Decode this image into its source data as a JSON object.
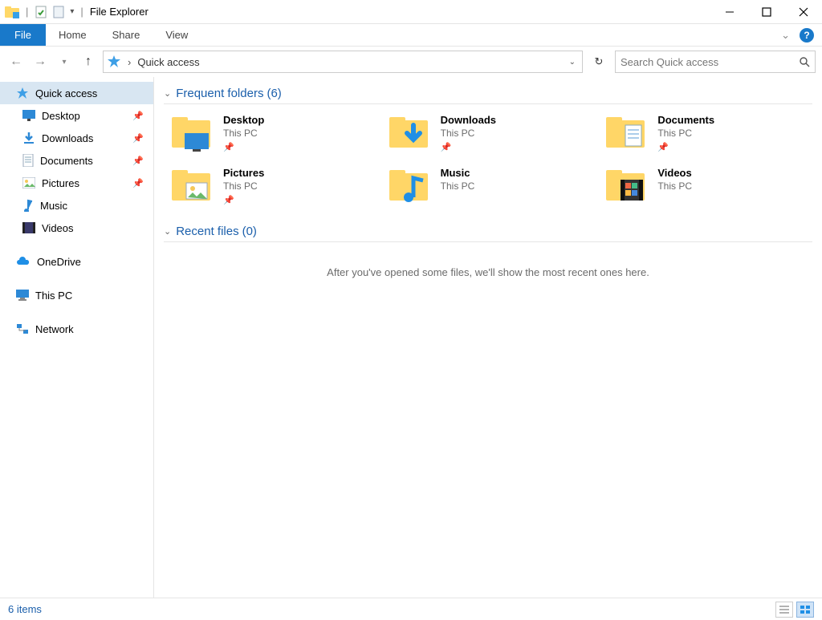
{
  "titlebar": {
    "title": "File Explorer"
  },
  "ribbon": {
    "file": "File",
    "home": "Home",
    "share": "Share",
    "view": "View"
  },
  "address": {
    "location": "Quick access"
  },
  "search": {
    "placeholder": "Search Quick access"
  },
  "sidebar": {
    "quick_access": "Quick access",
    "items": [
      {
        "label": "Desktop"
      },
      {
        "label": "Downloads"
      },
      {
        "label": "Documents"
      },
      {
        "label": "Pictures"
      },
      {
        "label": "Music"
      },
      {
        "label": "Videos"
      }
    ],
    "onedrive": "OneDrive",
    "thispc": "This PC",
    "network": "Network"
  },
  "sections": {
    "frequent": {
      "title": "Frequent folders",
      "count": "(6)"
    },
    "recent": {
      "title": "Recent files",
      "count": "(0)",
      "empty": "After you've opened some files, we'll show the most recent ones here."
    }
  },
  "folders": [
    {
      "name": "Desktop",
      "loc": "This PC",
      "pinned": true
    },
    {
      "name": "Downloads",
      "loc": "This PC",
      "pinned": true
    },
    {
      "name": "Documents",
      "loc": "This PC",
      "pinned": true
    },
    {
      "name": "Pictures",
      "loc": "This PC",
      "pinned": true
    },
    {
      "name": "Music",
      "loc": "This PC",
      "pinned": false
    },
    {
      "name": "Videos",
      "loc": "This PC",
      "pinned": false
    }
  ],
  "status": {
    "text": "6 items"
  }
}
